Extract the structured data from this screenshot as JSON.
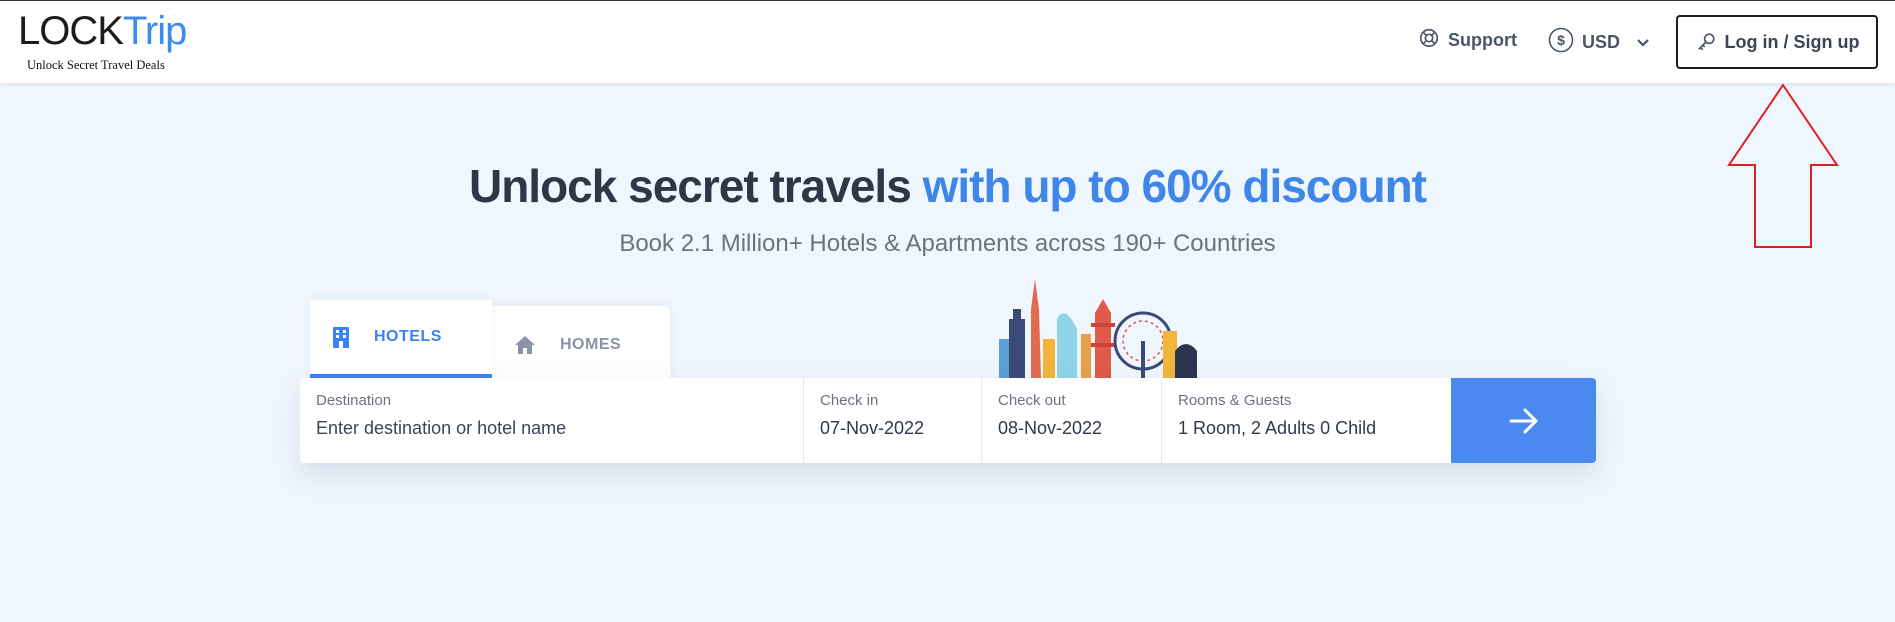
{
  "header": {
    "logo": {
      "part1": "LOCK",
      "part2": "Trip",
      "tagline": "Unlock Secret Travel Deals"
    },
    "support_label": "Support",
    "currency_label": "USD",
    "login_label": "Log in / Sign up"
  },
  "hero": {
    "title_main": "Unlock secret travels ",
    "title_accent": "with up to 60% discount",
    "subtitle": "Book 2.1 Million+ Hotels & Apartments across 190+ Countries"
  },
  "tabs": [
    {
      "label": "HOTELS",
      "active": true
    },
    {
      "label": "HOMES",
      "active": false
    }
  ],
  "search": {
    "destination": {
      "label": "Destination",
      "placeholder": "Enter destination or hotel name"
    },
    "checkin": {
      "label": "Check in",
      "value": "07-Nov-2022"
    },
    "checkout": {
      "label": "Check out",
      "value": "08-Nov-2022"
    },
    "guests": {
      "label": "Rooms & Guests",
      "value": "1 Room, 2 Adults 0 Child"
    }
  },
  "colors": {
    "accent": "#3b82f6",
    "background": "#f0f6fd",
    "annotation": "#e02020"
  },
  "icons": [
    "support-icon",
    "dollar-icon",
    "chevron-down-icon",
    "key-icon",
    "building-icon",
    "home-icon",
    "arrow-right-icon"
  ]
}
